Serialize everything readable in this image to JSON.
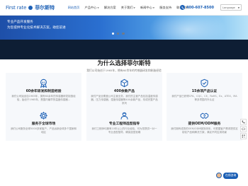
{
  "header": {
    "logo_en": "First rate",
    "logo_cn": "菲尔斯特",
    "nav": [
      {
        "label": "网站首页",
        "active": true
      },
      {
        "label": "产品中心",
        "dropdown": true
      },
      {
        "label": "解决方案"
      },
      {
        "label": "关于我们",
        "dropdown": true
      },
      {
        "label": "新闻中心",
        "dropdown": true
      },
      {
        "label": "服务支持"
      },
      {
        "label": "联系我们"
      }
    ],
    "hotline": "400-607-8500",
    "language": "Language"
  },
  "banner": {
    "line1": "专业产品开发服务",
    "line2": "为您提供专业化技术解决方案，助您前进"
  },
  "carousel": {
    "slides": 3,
    "active_index": 0
  },
  "why": {
    "title": "为什么选择菲尔斯特",
    "subtitle": "我们公司始创于1965年，拥有60余年的传感器研发和制造经验"
  },
  "cards": [
    {
      "icon": "award-icon",
      "title": "60余年研发和制造经验",
      "desc": "我们公司始创自1965年，拥有60余年的传感器研发制造经验，始创于1965年，是国内最早的温度传感器..."
    },
    {
      "icon": "cube-icon",
      "title": "400余款产品",
      "desc": "我们产品全覆盖公司主营业务，我们的主营产品包括温度传感器、压力传感器、湿度传感器等400余款产品，形成完整产品系列"
    },
    {
      "icon": "shield-icon",
      "title": "15余项产品认证",
      "desc": "我们产品已获得CPA、CQC、CE、RoHS、Ex、ATEX、MA等多项国内外认证"
    },
    {
      "icon": "gear-icon",
      "title": "服务于全球市场",
      "desc": "我们公司服务全球5000多家客户，产品远销全球多个国家和地区"
    },
    {
      "icon": "engineer-icon",
      "title": "专业工程师选型指导",
      "desc": "我们工程师均拥有10年以上的行业经验，可为您提供一对一专业选型指导，确保选型准确"
    },
    {
      "icon": "handshake-icon",
      "title": "提供OEM/ODM服务",
      "desc": "我们拥有成熟的OEM/ODM服务体系，可根据客户需求提供定制化产品和解决方案，满足不同应用场景"
    }
  ],
  "chat": {
    "label": "在线咨询"
  },
  "colors": {
    "brand": "#1b5fb5",
    "card_bg": "#f6f8fb",
    "carousel_bg": "#0e1e34"
  }
}
